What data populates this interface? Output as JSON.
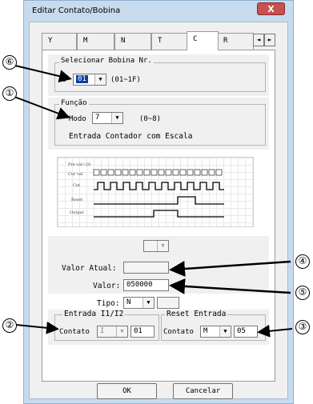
{
  "window": {
    "title": "Editar Contato/Bobina",
    "close_glyph": "X"
  },
  "tabs": [
    {
      "label": "Y"
    },
    {
      "label": "M"
    },
    {
      "label": "N"
    },
    {
      "label": "T"
    },
    {
      "label": "C",
      "active": true
    },
    {
      "label": "R"
    }
  ],
  "tab_nav": {
    "prev": "◄",
    "next": "►"
  },
  "coil_select": {
    "legend": "Selecionar Bobina Nr.",
    "prefix": "C",
    "value": "01",
    "range": "(01~1F)"
  },
  "function": {
    "legend": "Função",
    "mode_label": "Modo",
    "mode_value": "7",
    "mode_range": "(0~8)",
    "description": "Entrada Contador com Escala"
  },
  "timing_diagram": {
    "labels": [
      "Pre val=20",
      "Cur val",
      "Cnt",
      "Reset",
      "Output"
    ],
    "cur_val_digits": "0 1 2 3 4 5 6 7 8 9 10 0 1 2 3 4 5 6 7 8 9 10 11"
  },
  "values": {
    "top_select": "",
    "current_label": "Valor Atual:",
    "current_value": "",
    "value_label": "Valor:",
    "value": "050000",
    "type_label": "Tipo:",
    "type_value": "N",
    "type_extra": ""
  },
  "input_group": {
    "legend": "Entrada I1/I2",
    "contact_label": "Contato",
    "type": "I",
    "number": "01"
  },
  "reset_group": {
    "legend": "Reset Entrada",
    "contact_label": "Contato",
    "type": "M",
    "number": "05"
  },
  "buttons": {
    "ok": "OK",
    "cancel": "Cancelar"
  },
  "callouts": {
    "c1": "①",
    "c2": "②",
    "c3": "③",
    "c4": "④",
    "c5": "⑤",
    "c6": "⑥"
  }
}
